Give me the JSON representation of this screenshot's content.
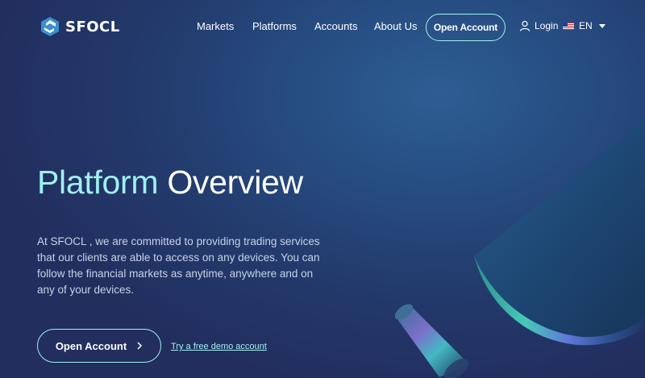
{
  "brand": {
    "name": "SFOCL",
    "logo_icon": "sfocl-logo-icon"
  },
  "nav": {
    "items": [
      {
        "label": "Markets"
      },
      {
        "label": "Platforms"
      },
      {
        "label": "Accounts"
      },
      {
        "label": "About Us"
      }
    ],
    "open_account_label": "Open Account",
    "login_label": "Login",
    "login_icon": "user-icon",
    "language": {
      "code": "EN",
      "flag_icon": "us-flag-icon"
    }
  },
  "hero": {
    "title_accent": "Platform",
    "title_rest": "Overview",
    "description": "At SFOCL , we are committed to providing trading services that our clients are able to access on any devices. You can follow the financial markets as anytime, anywhere and on any of your devices.",
    "cta_label": "Open Account",
    "demo_link": "Try a free demo account"
  },
  "colors": {
    "accent": "#9ff0f0",
    "background": "#233a6c",
    "text_muted": "#c7d2e8"
  }
}
